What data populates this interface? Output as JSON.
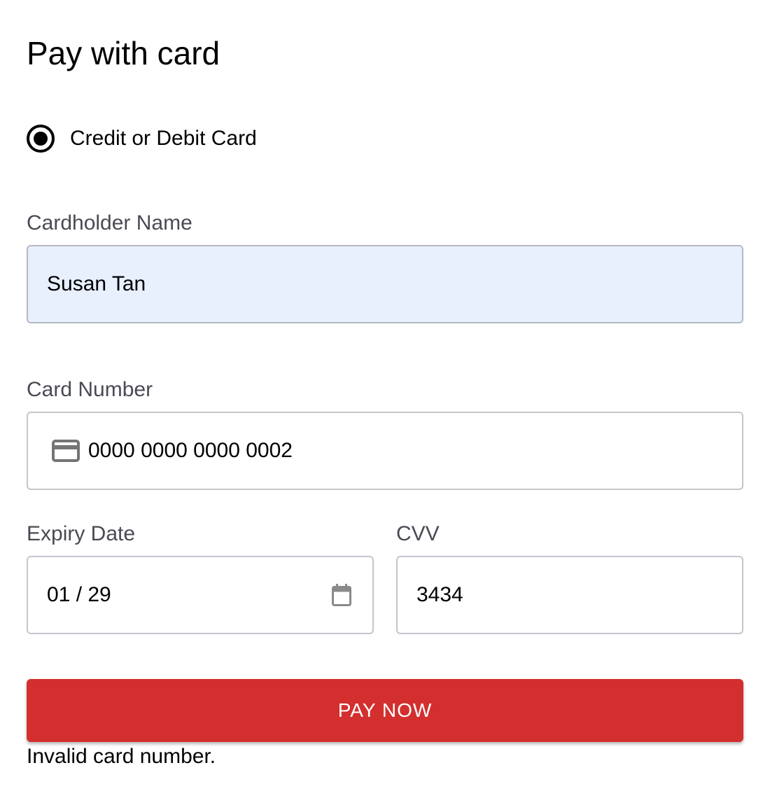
{
  "header": {
    "title": "Pay with card"
  },
  "payment_method": {
    "label": "Credit or Debit Card",
    "selected": true
  },
  "form": {
    "cardholder_name": {
      "label": "Cardholder Name",
      "value": "Susan Tan"
    },
    "card_number": {
      "label": "Card Number",
      "value": "0000 0000 0000 0002",
      "icon": "credit-card-icon"
    },
    "expiry_date": {
      "label": "Expiry Date",
      "value": "01 / 29",
      "icon": "calendar-icon"
    },
    "cvv": {
      "label": "CVV",
      "value": "3434"
    }
  },
  "actions": {
    "pay_label": "PAY NOW"
  },
  "status": {
    "error_message": "Invalid card number."
  },
  "colors": {
    "button_background": "#d32f2f",
    "autofill_background": "#e8f0fe",
    "field_border": "#c4c6cc",
    "label_text": "#4a4a55"
  }
}
